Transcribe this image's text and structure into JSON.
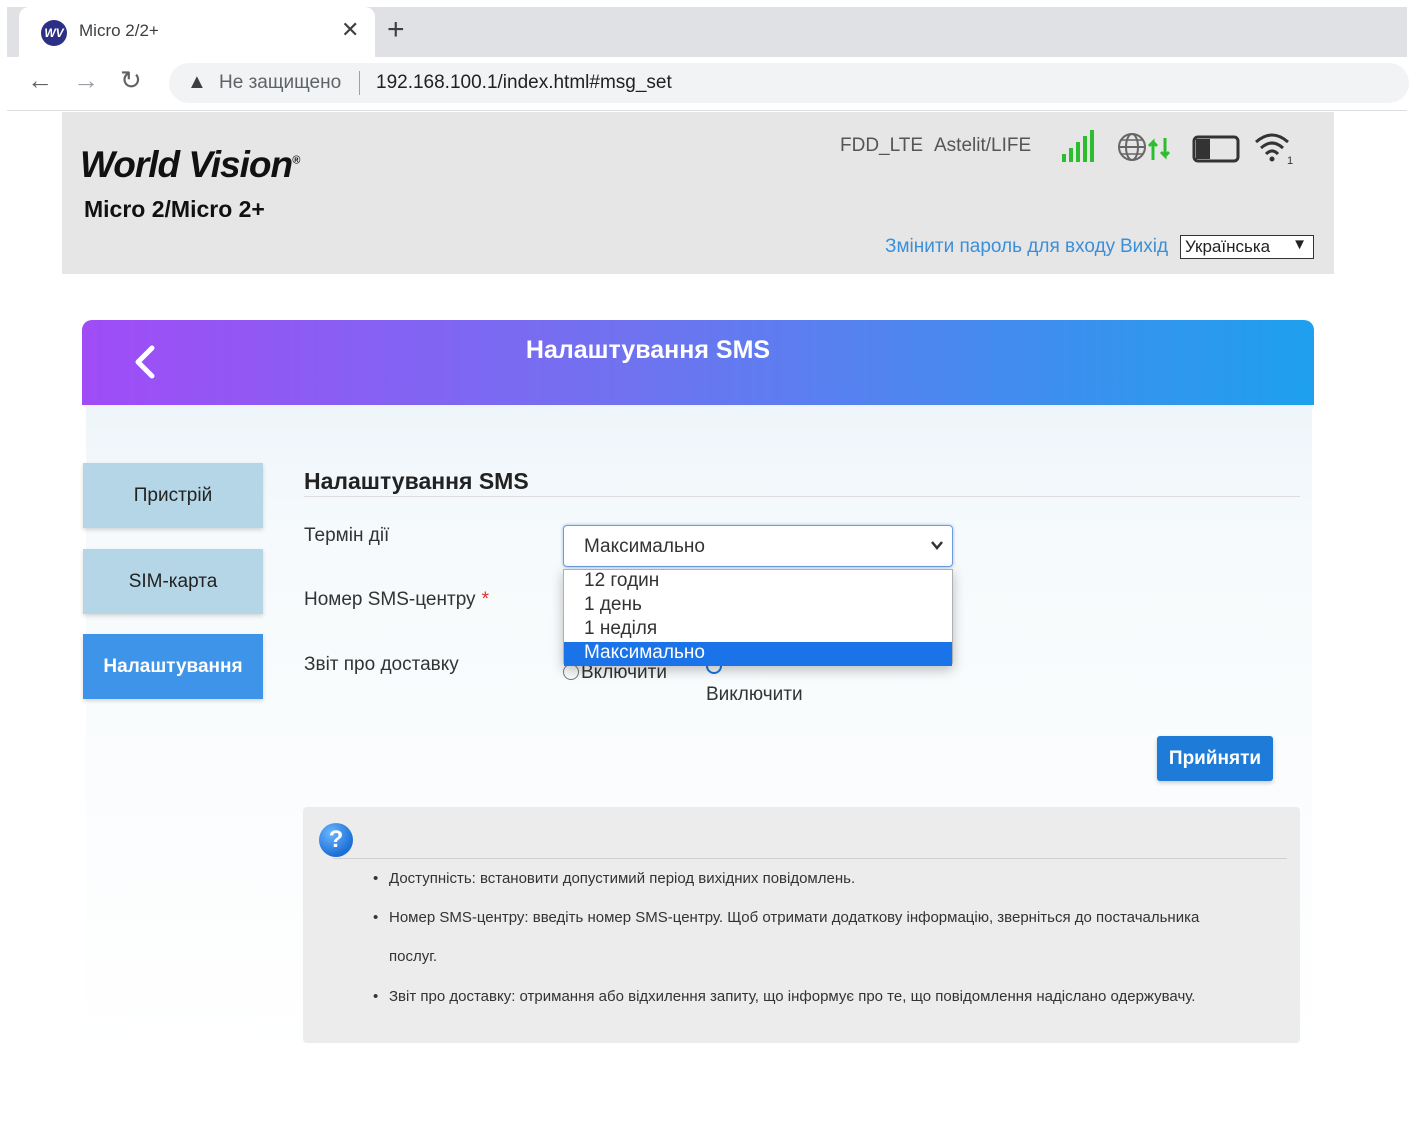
{
  "browser": {
    "tab_title": "Micro 2/2+",
    "favicon_text": "WV",
    "security_label": "Не защищено",
    "url": "192.168.100.1/index.html#msg_set"
  },
  "header": {
    "brand": "World Vision",
    "model": "Micro 2/Micro 2+",
    "network_type": "FDD_LTE",
    "operator": "Astelit/LIFE",
    "wifi_clients": "1",
    "change_password": "Змінити пароль для входу",
    "logout": "Вихід",
    "language": "Українська"
  },
  "banner": {
    "title": "Налаштування SMS"
  },
  "sidebar": {
    "items": [
      {
        "label": "Пристрій",
        "active": false
      },
      {
        "label": "SIM-карта",
        "active": false
      },
      {
        "label": "Налаштування",
        "active": true
      }
    ]
  },
  "form": {
    "section_title": "Налаштування SMS",
    "validity_label": "Термін дії",
    "validity_value": "Максимально",
    "validity_options": [
      "12 годин",
      "1 день",
      "1 неділя",
      "Максимально"
    ],
    "smsc_label": "Номер SMS-центру",
    "required_mark": "*",
    "delivery_label": "Звіт про доставку",
    "delivery_on": "Включити",
    "delivery_off": "Виключити",
    "apply": "Прийняти"
  },
  "help": {
    "items": [
      "Доступність: встановити допустимий період вихідних повідомлень.",
      "Номер SMS-центру: введіть номер SMS-центру. Щоб отримати додаткову інформацію, зверніться до постачальника",
      "послуг.",
      "Звіт про доставку: отримання або відхилення запиту, що інформує про те, що повідомлення надіслано одержувачу."
    ]
  },
  "colors": {
    "banner_start": "#a04cf6",
    "banner_end": "#1ea0ee",
    "accent": "#3e94e8",
    "signal": "#2ebd2e"
  }
}
